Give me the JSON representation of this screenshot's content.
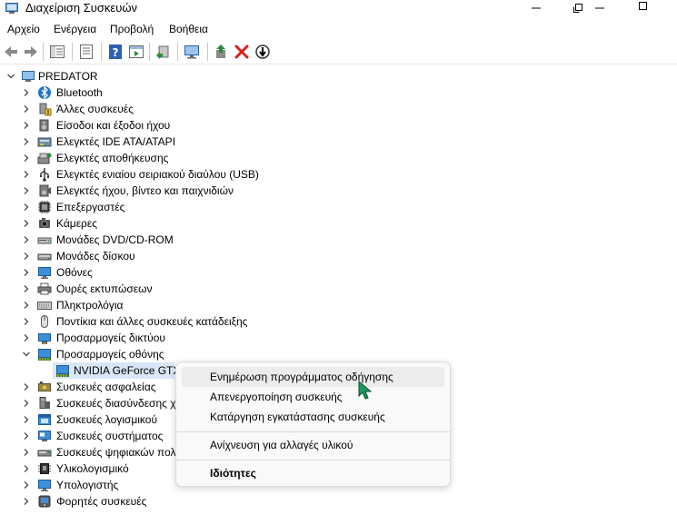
{
  "window": {
    "title": "Διαχείριση Συσκευών"
  },
  "menu": [
    "Αρχείο",
    "Ενέργεια",
    "Προβολή",
    "Βοήθεια"
  ],
  "tree": {
    "root": "PREDATOR",
    "categories": [
      {
        "label": "Bluetooth",
        "icon": "bluetooth-icon"
      },
      {
        "label": "Άλλες συσκευές",
        "icon": "unknown-device-icon"
      },
      {
        "label": "Είσοδοι και έξοδοι ήχου",
        "icon": "speaker-icon"
      },
      {
        "label": "Ελεγκτές IDE ATA/ATAPI",
        "icon": "ide-controller-icon"
      },
      {
        "label": "Ελεγκτές αποθήκευσης",
        "icon": "storage-controller-icon"
      },
      {
        "label": "Ελεγκτές ενιαίου σειριακού διαύλου (USB)",
        "icon": "usb-icon"
      },
      {
        "label": "Ελεγκτές ήχου, βίντεο και παιχνιδιών",
        "icon": "sound-video-icon"
      },
      {
        "label": "Επεξεργαστές",
        "icon": "processor-icon"
      },
      {
        "label": "Κάμερες",
        "icon": "camera-icon"
      },
      {
        "label": "Μονάδες DVD/CD-ROM",
        "icon": "dvd-drive-icon"
      },
      {
        "label": "Μονάδες δίσκου",
        "icon": "disk-drive-icon"
      },
      {
        "label": "Οθόνες",
        "icon": "monitor-icon"
      },
      {
        "label": "Ουρές εκτυπώσεων",
        "icon": "print-queue-icon"
      },
      {
        "label": "Πληκτρολόγια",
        "icon": "keyboard-icon"
      },
      {
        "label": "Ποντίκια και άλλες συσκευές κατάδειξης",
        "icon": "mouse-icon"
      },
      {
        "label": "Προσαρμογείς δικτύου",
        "icon": "network-adapter-icon"
      },
      {
        "label": "Προσαρμογείς οθόνης",
        "icon": "display-adapter-icon",
        "expanded": true
      },
      {
        "label": "NVIDIA GeForce GTX",
        "icon": "display-adapter-icon",
        "child": true
      },
      {
        "label": "Συσκευές ασφαλείας",
        "icon": "security-device-icon"
      },
      {
        "label": "Συσκευές διασύνδεσης χ",
        "icon": "hid-icon"
      },
      {
        "label": "Συσκευές λογισμικού",
        "icon": "software-device-icon"
      },
      {
        "label": "Συσκευές συστήματος",
        "icon": "system-device-icon"
      },
      {
        "label": "Συσκευές ψηφιακών πολ",
        "icon": "portable-device-icon"
      },
      {
        "label": "Υλικολογισμικό",
        "icon": "firmware-icon"
      },
      {
        "label": "Υπολογιστής",
        "icon": "computer-icon"
      },
      {
        "label": "Φορητές συσκευές",
        "icon": "portable-devices-icon"
      }
    ]
  },
  "context_menu": {
    "update_driver": "Ενημέρωση προγράμματος οδήγησης",
    "disable_device": "Απενεργοποίηση συσκευής",
    "uninstall_device": "Κατάργηση εγκατάστασης συσκευής",
    "scan_hardware": "Ανίχνευση για αλλαγές υλικού",
    "properties": "Ιδιότητες"
  },
  "colors": {
    "selection": "#d9e6f7",
    "menu_hover": "#ececec",
    "accent_blue": "#1e73c8",
    "delete_red": "#d9201a",
    "cursor_green": "#1d9b5f"
  }
}
